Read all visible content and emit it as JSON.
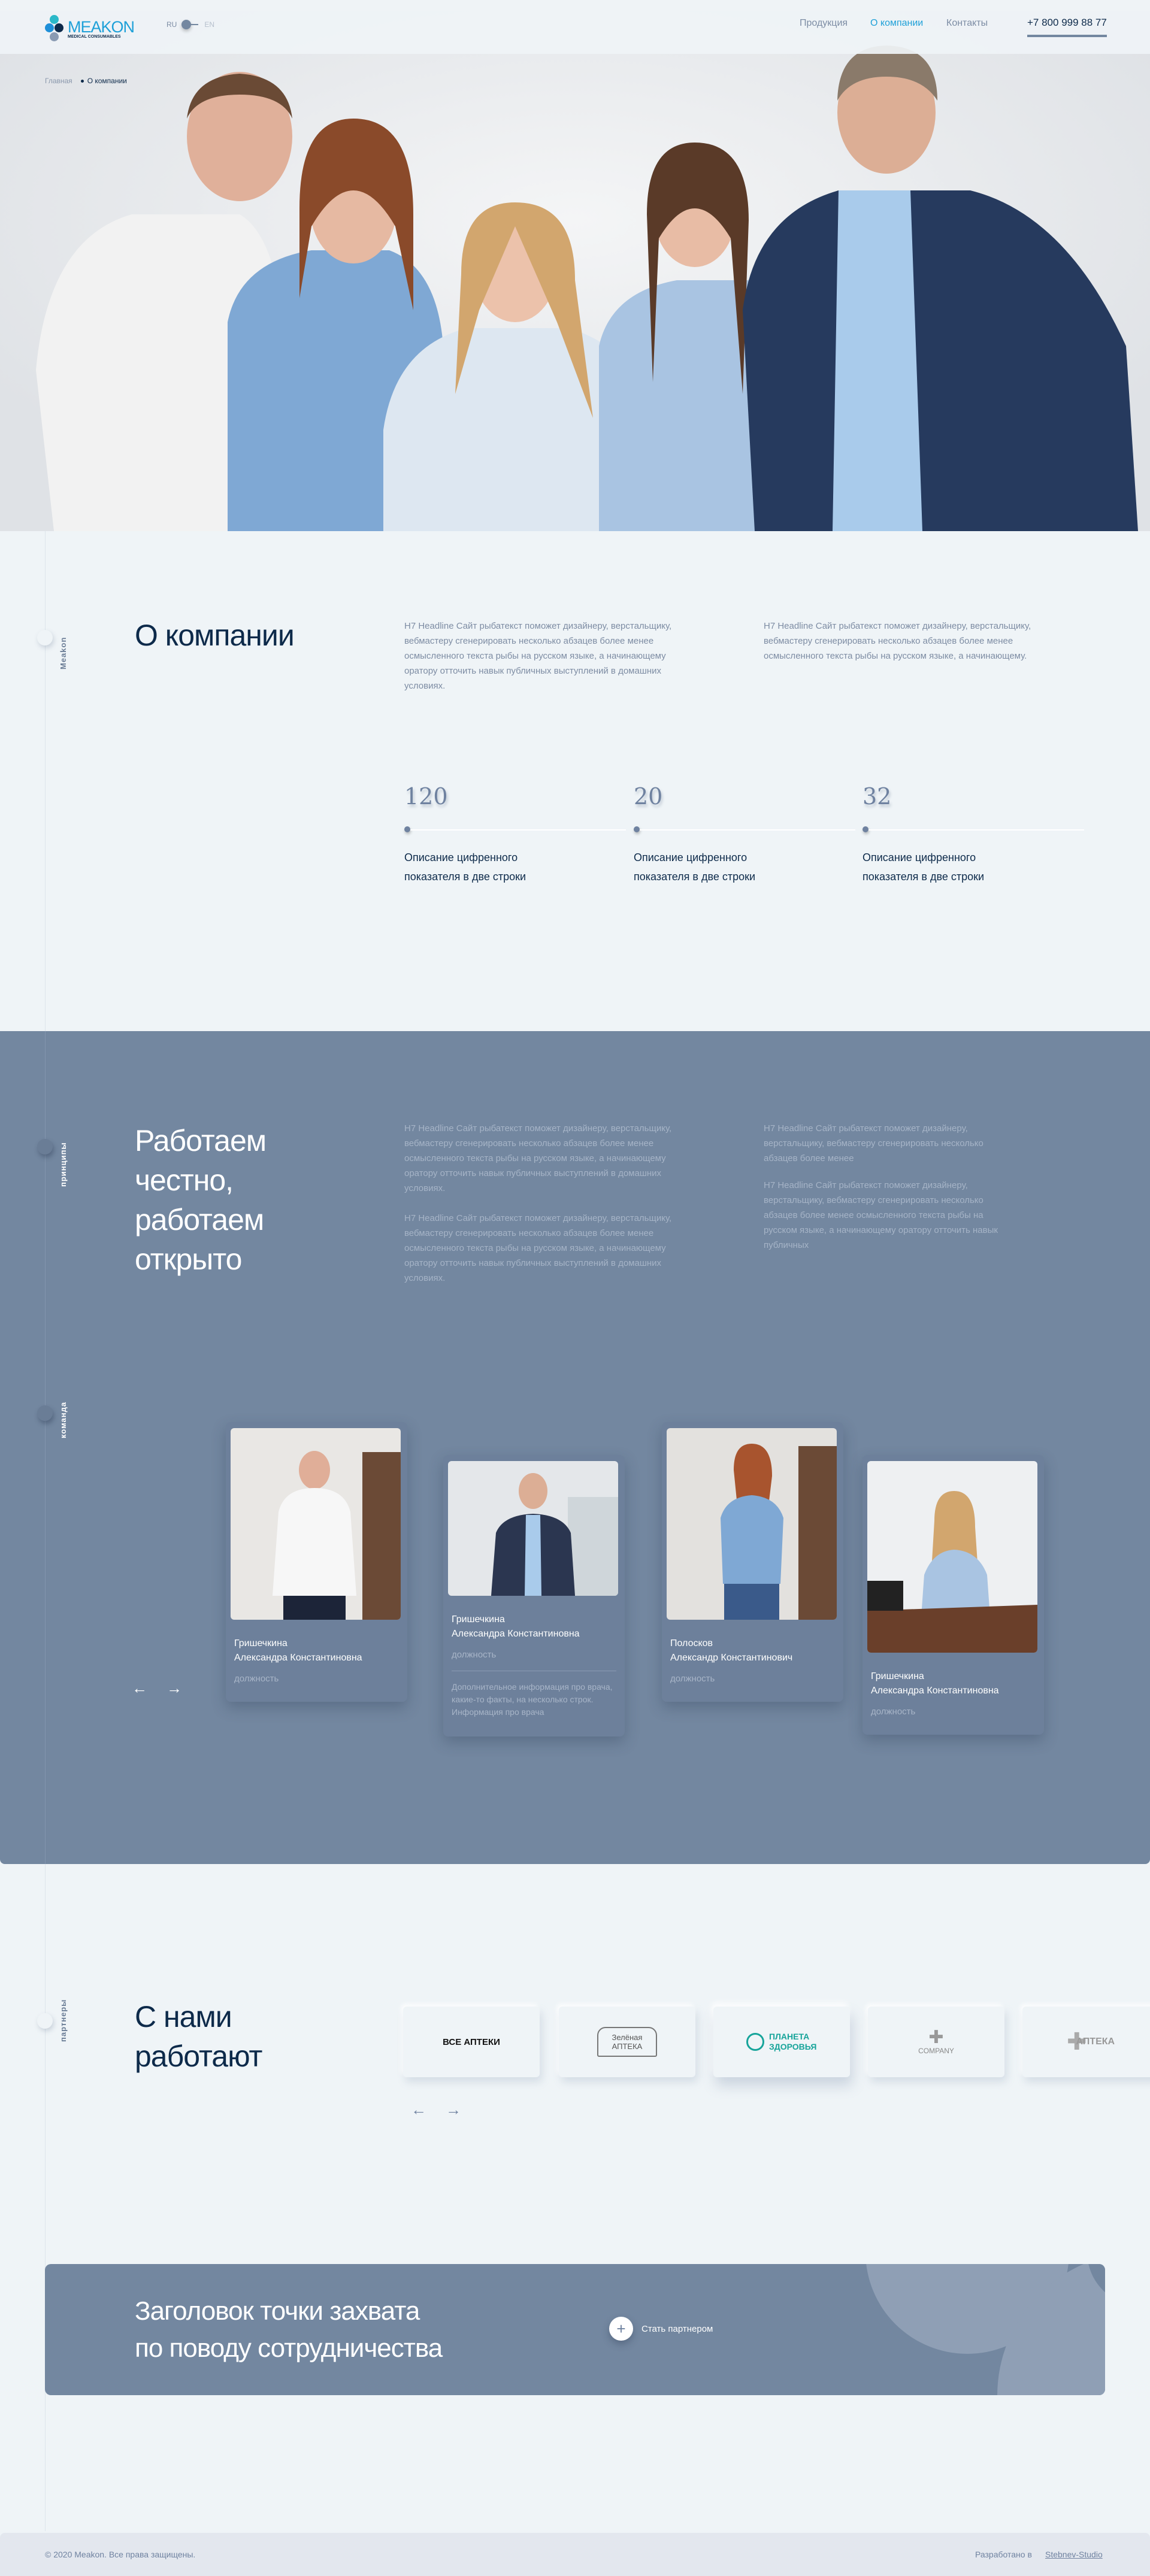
{
  "header": {
    "logo": {
      "name": "MEAKON",
      "tagline": "MEDICAL CONSUMABLES"
    },
    "lang": {
      "ru": "RU",
      "en": "EN"
    },
    "nav": [
      {
        "label": "Продукция",
        "active": false
      },
      {
        "label": "О компании",
        "active": true
      },
      {
        "label": "Контакты",
        "active": false
      }
    ],
    "phone": "+7 800 999 88 77"
  },
  "breadcrumbs": [
    "Главная",
    "О компании"
  ],
  "about": {
    "side_label": "Meakon",
    "title": "О компании",
    "paragraphs": [
      "H7 Headline Сайт рыбатекст поможет дизайнеру, верстальщику, вебмастеру сгенерировать несколько абзацев более менее осмысленного текста рыбы на русском языке, а начинающему оратору отточить навык публичных выступлений в домашних условиях.",
      "H7 Headline Сайт рыбатекст поможет дизайнеру, верстальщику, вебмастеру сгенерировать несколько абзацев более менее осмысленного текста рыбы на русском языке, а начинающему."
    ],
    "stats": [
      {
        "value": "120",
        "label": "Описание цифренного показателя в две строки"
      },
      {
        "value": "20",
        "label": "Описание цифренного показателя в две строки"
      },
      {
        "value": "32",
        "label": "Описание цифренного показателя в две строки"
      }
    ]
  },
  "principles": {
    "side_label": "принципы",
    "title_lines": [
      "Работаем",
      "честно,",
      "работаем",
      "открыто"
    ],
    "col1": [
      "H7 Headline Сайт рыбатекст поможет дизайнеру, верстальщику, вебмастеру сгенерировать несколько абзацев более менее осмысленного текста рыбы на русском языке, а начинающему оратору отточить навык публичных выступлений в домашних условиях.",
      "H7 Headline Сайт рыбатекст поможет дизайнеру, верстальщику, вебмастеру сгенерировать несколько абзацев более менее осмысленного текста рыбы на русском языке, а начинающему оратору отточить навык публичных выступлений в домашних условиях."
    ],
    "col2": [
      "H7 Headline Сайт рыбатекст поможет дизайнеру, верстальщику, вебмастеру сгенерировать несколько абзацев более менее",
      "H7 Headline Сайт рыбатекст поможет дизайнеру, верстальщику, вебмастеру сгенерировать несколько абзацев более менее осмысленного текста рыбы на русском языке, а начинающему оратору отточить навык публичных"
    ]
  },
  "team": {
    "side_label": "команда",
    "members": [
      {
        "surname": "Гришечкина",
        "name": "Александра Константиновна",
        "role": "должность"
      },
      {
        "surname": "Гришечкина",
        "name": "Александра Константиновна",
        "role": "должность",
        "info": "Дополнительное информация про врача, какие-то факты, на несколько строк. Информация про врача"
      },
      {
        "surname": "Полосков",
        "name": "Александр Константинович",
        "role": "должность"
      },
      {
        "surname": "Гришечкина",
        "name": "Александра Константиновна",
        "role": "должность"
      }
    ],
    "prev_icon": "arrow-left-icon",
    "next_icon": "arrow-right-icon"
  },
  "partners": {
    "side_label": "партнеры",
    "title_lines": [
      "С нами",
      "работают"
    ],
    "logos": [
      "ВСЕ АПТЕКИ",
      "Зелёная АПТЕКА",
      "ПЛАНЕТА ЗДОРОВЬЯ",
      "COMPANY",
      "АПТЕКА"
    ]
  },
  "cta": {
    "title_lines": [
      "Заголовок точки захвата",
      "по поводу сотрудничества"
    ],
    "button": "Стать партнером"
  },
  "footer": {
    "copyright": "© 2020 Meakon. Все права защищены.",
    "dev_prefix": "Разработано в",
    "dev_link": "Stebnev-Studio"
  },
  "colors": {
    "accent": "#1ea0d8",
    "navy": "#0d2a4a",
    "slate": "#7387a0",
    "bg": "#eff4f7"
  }
}
